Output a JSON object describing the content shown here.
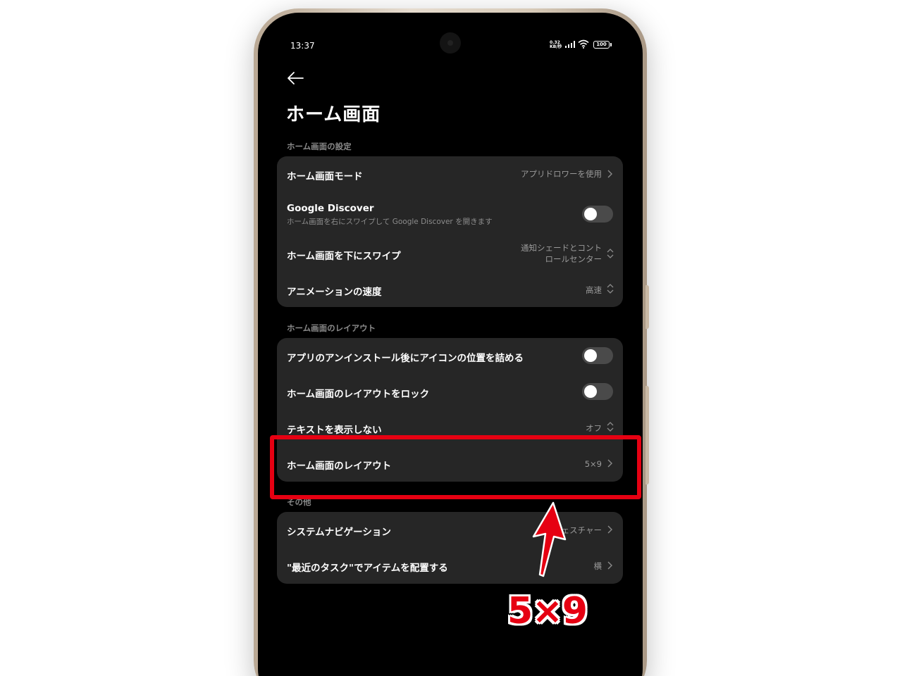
{
  "status_bar": {
    "time": "13:37",
    "net_speed_value": "0.32",
    "net_speed_unit": "KB/秒",
    "battery": "100"
  },
  "header": {
    "title": "ホーム画面"
  },
  "sections": {
    "settings": {
      "label": "ホーム画面の設定",
      "mode_title": "ホーム画面モード",
      "mode_value": "アプリドロワーを使用",
      "discover_title": "Google Discover",
      "discover_sub": "ホーム画面を右にスワイプして Google Discover を開きます",
      "discover_enabled": false,
      "swipe_title": "ホーム画面を下にスワイプ",
      "swipe_value_line1": "通知シェードとコント",
      "swipe_value_line2": "ロールセンター",
      "anim_title": "アニメーションの速度",
      "anim_value": "高速"
    },
    "layout": {
      "label": "ホーム画面のレイアウト",
      "autofill_title": "アプリのアンインストール後にアイコンの位置を詰める",
      "autofill_enabled": false,
      "lock_title": "ホーム画面のレイアウトをロック",
      "lock_enabled": false,
      "hide_text_title": "テキストを表示しない",
      "hide_text_value": "オフ",
      "grid_title": "ホーム画面のレイアウト",
      "grid_value": "5×9"
    },
    "other": {
      "label": "その他",
      "nav_title": "システムナビゲーション",
      "nav_value": "ジェスチャー",
      "recents_title": "\"最近のタスク\"でアイテムを配置する",
      "recents_value": "横"
    }
  },
  "annotation": {
    "label": "5×9",
    "color": "#e60012"
  }
}
